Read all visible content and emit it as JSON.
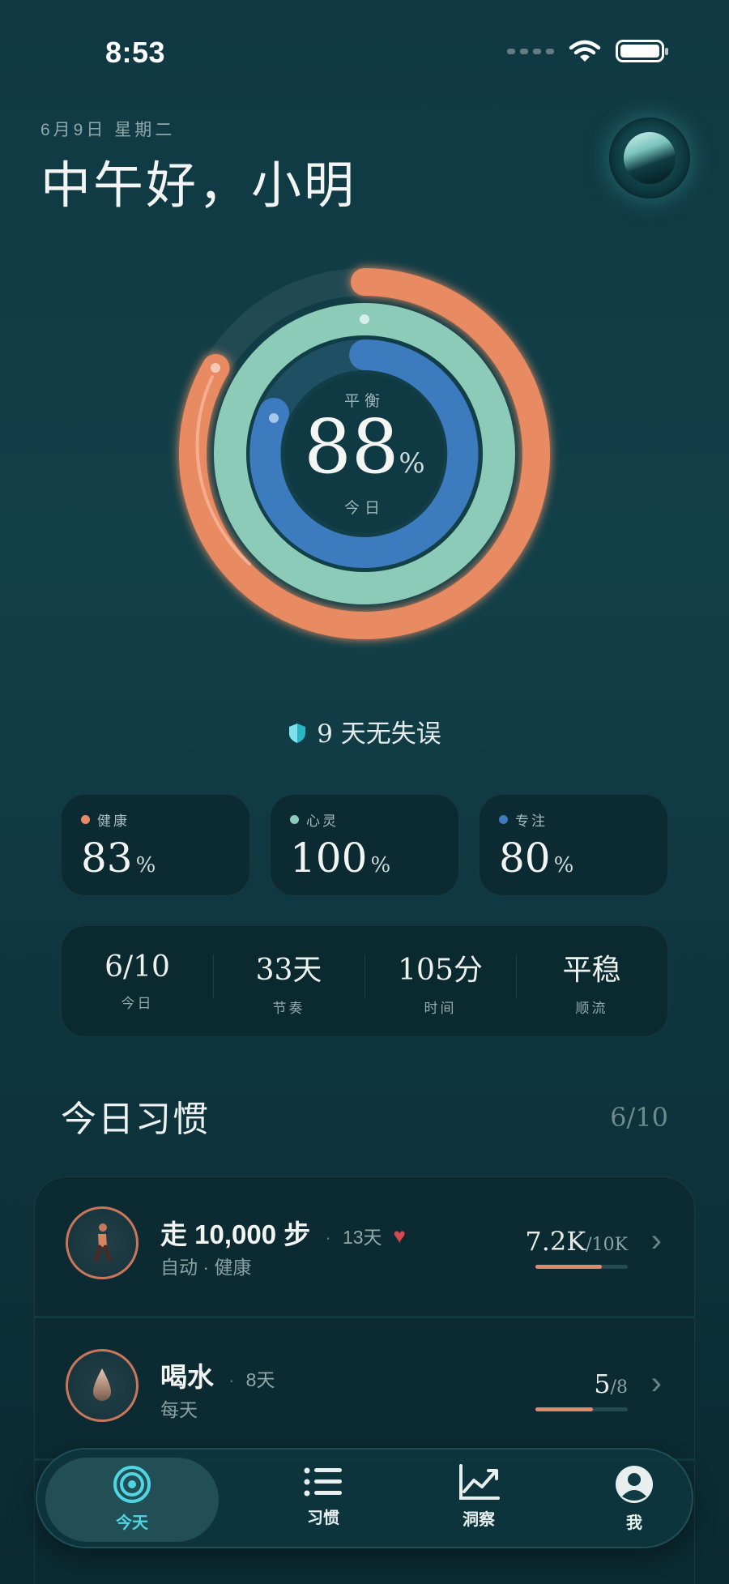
{
  "status_bar": {
    "time": "8:53"
  },
  "header": {
    "date": "6月9日 星期二",
    "greeting": "中午好，小明"
  },
  "rings": {
    "center_label": "平衡",
    "center_value": "88",
    "center_unit": "%",
    "center_sub": "今日",
    "colors": {
      "outer": "#e88a62",
      "middle": "#8ccbb8",
      "inner": "#3d7bbf"
    }
  },
  "streak": {
    "text": "9 天无失误"
  },
  "categories": [
    {
      "label": "健康",
      "value": "83",
      "unit": "%",
      "color": "#e88a62"
    },
    {
      "label": "心灵",
      "value": "100",
      "unit": "%",
      "color": "#8ccbb8"
    },
    {
      "label": "专注",
      "value": "80",
      "unit": "%",
      "color": "#3d7bbf"
    }
  ],
  "stats": [
    {
      "value": "6/10",
      "label": "今日"
    },
    {
      "value": "33天",
      "label": "节奏"
    },
    {
      "value": "105分",
      "label": "时间"
    },
    {
      "value": "平稳",
      "label": "顺流"
    }
  ],
  "habits": {
    "title": "今日习惯",
    "count": "6/10",
    "items": [
      {
        "name": "走 10,000 步",
        "streak": "13天",
        "meta": "自动 · 健康",
        "progress": "7.2K",
        "target": "/10K",
        "fraction": 0.72,
        "icon": "walking-icon"
      },
      {
        "name": "喝水",
        "streak": "8天",
        "meta": "每天",
        "progress": "5",
        "target": "/8",
        "fraction": 0.625,
        "icon": "water-drop-icon"
      }
    ]
  },
  "tabbar": {
    "tabs": [
      {
        "label": "今天",
        "icon": "target-icon",
        "active": true
      },
      {
        "label": "习惯",
        "icon": "list-icon",
        "active": false
      },
      {
        "label": "洞察",
        "icon": "chart-icon",
        "active": false
      },
      {
        "label": "我",
        "icon": "profile-icon",
        "active": false
      }
    ]
  }
}
